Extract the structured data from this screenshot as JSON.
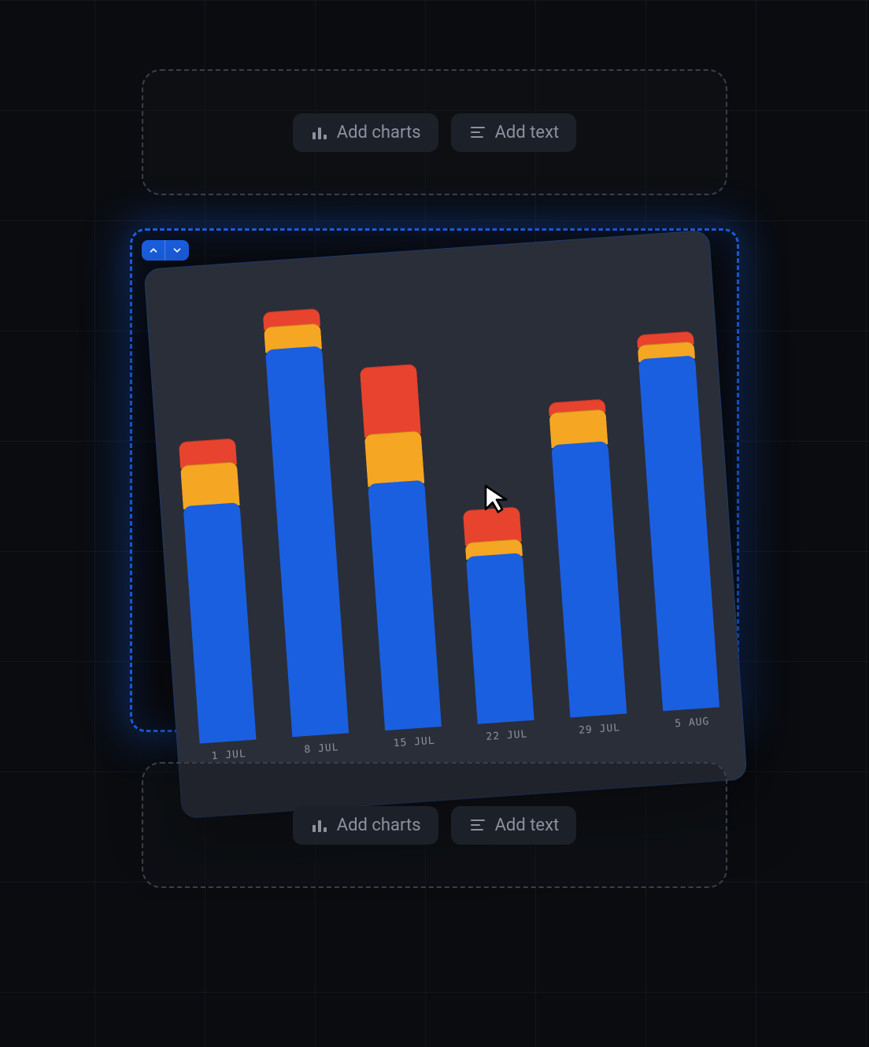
{
  "buttons": {
    "add_charts": "Add charts",
    "add_text": "Add text"
  },
  "colors": {
    "blue": "#1a5fe0",
    "orange": "#f5a623",
    "red": "#e8432e",
    "panel": "#2a2e38",
    "bg": "#0a0c10"
  },
  "chart_data": {
    "type": "bar",
    "stacked": true,
    "title": "",
    "xlabel": "",
    "ylabel": "",
    "ylim": [
      0,
      100
    ],
    "categories": [
      "1 JUL",
      "8 JUL",
      "15 JUL",
      "22 JUL",
      "29 JUL",
      "5 AUG"
    ],
    "series": [
      {
        "name": "blue",
        "color": "#1a5fe0",
        "values": [
          54,
          88,
          56,
          38,
          62,
          80
        ]
      },
      {
        "name": "orange",
        "color": "#f5a623",
        "values": [
          10,
          6,
          12,
          4,
          8,
          4
        ]
      },
      {
        "name": "red",
        "color": "#e8432e",
        "values": [
          6,
          4,
          16,
          8,
          3,
          3
        ]
      }
    ]
  }
}
